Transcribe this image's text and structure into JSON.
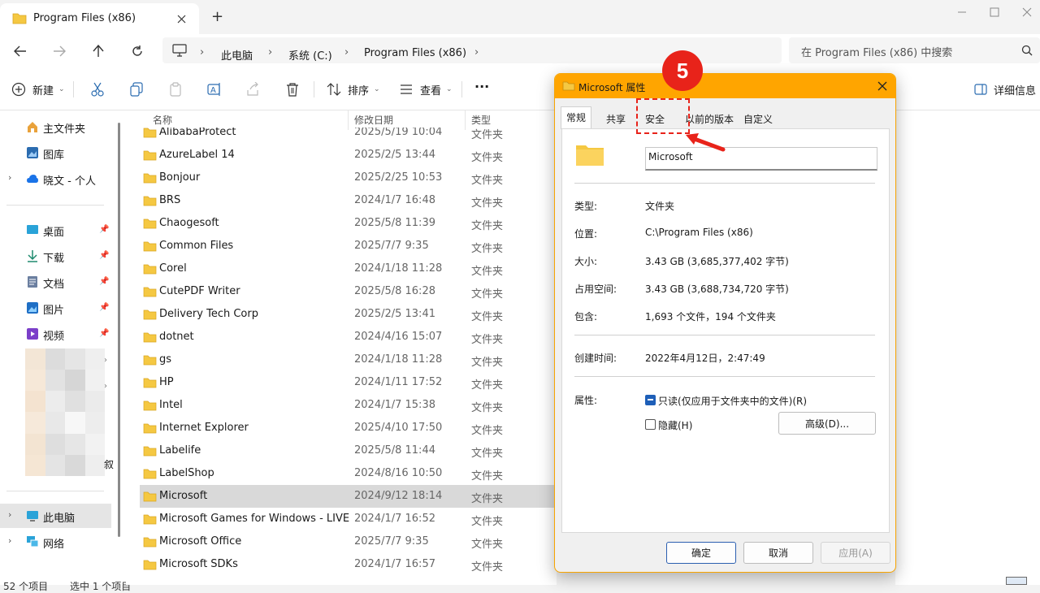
{
  "window": {
    "tab_title": "Program Files (x86)",
    "new_tab": "+"
  },
  "address": {
    "crumbs": [
      "此电脑",
      "系统 (C:)",
      "Program Files (x86)"
    ],
    "search_placeholder": "在 Program Files (x86) 中搜索"
  },
  "toolbar": {
    "new": "新建",
    "sort": "排序",
    "view": "查看",
    "more": "···",
    "details": "详细信息"
  },
  "nav": {
    "home": "主文件夹",
    "gallery": "图库",
    "onedrive": "晓文 - 个人",
    "desktop": "桌面",
    "downloads": "下载",
    "documents": "文档",
    "pictures": "图片",
    "videos": "视频",
    "this_pc": "此电脑",
    "network": "网络",
    "blur_suffix": "叙"
  },
  "list": {
    "headers": {
      "name": "名称",
      "date": "修改日期",
      "type": "类型"
    },
    "rows": [
      {
        "name": "AlibabaProtect",
        "date": "2025/5/19 10:04",
        "type": "文件夹"
      },
      {
        "name": "AzureLabel 14",
        "date": "2025/2/5 13:44",
        "type": "文件夹"
      },
      {
        "name": "Bonjour",
        "date": "2025/2/25 10:53",
        "type": "文件夹"
      },
      {
        "name": "BRS",
        "date": "2024/1/7 16:48",
        "type": "文件夹"
      },
      {
        "name": "Chaogesoft",
        "date": "2025/5/8 11:39",
        "type": "文件夹"
      },
      {
        "name": "Common Files",
        "date": "2025/7/7 9:35",
        "type": "文件夹"
      },
      {
        "name": "Corel",
        "date": "2024/1/18 11:28",
        "type": "文件夹"
      },
      {
        "name": "CutePDF Writer",
        "date": "2025/5/8 16:28",
        "type": "文件夹"
      },
      {
        "name": "Delivery Tech Corp",
        "date": "2025/2/5 13:41",
        "type": "文件夹"
      },
      {
        "name": "dotnet",
        "date": "2024/4/16 15:07",
        "type": "文件夹"
      },
      {
        "name": "gs",
        "date": "2024/1/18 11:28",
        "type": "文件夹"
      },
      {
        "name": "HP",
        "date": "2024/1/11 17:52",
        "type": "文件夹"
      },
      {
        "name": "Intel",
        "date": "2024/1/7 15:38",
        "type": "文件夹"
      },
      {
        "name": "Internet Explorer",
        "date": "2025/4/10 17:50",
        "type": "文件夹"
      },
      {
        "name": "Labelife",
        "date": "2025/5/8 11:44",
        "type": "文件夹"
      },
      {
        "name": "LabelShop",
        "date": "2024/8/16 10:50",
        "type": "文件夹"
      },
      {
        "name": "Microsoft",
        "date": "2024/9/12 18:14",
        "type": "文件夹"
      },
      {
        "name": "Microsoft Games for Windows - LIVE",
        "date": "2024/1/7 16:52",
        "type": "文件夹"
      },
      {
        "name": "Microsoft Office",
        "date": "2025/7/7 9:35",
        "type": "文件夹"
      },
      {
        "name": "Microsoft SDKs",
        "date": "2024/1/7 16:57",
        "type": "文件夹"
      }
    ]
  },
  "status": {
    "count": "52 个项目",
    "selected": "选中 1 个项目"
  },
  "dialog": {
    "title": "Microsoft 属性",
    "tabs": [
      "常规",
      "共享",
      "安全",
      "以前的版本",
      "自定义"
    ],
    "folder_name": "Microsoft",
    "props": {
      "type_label": "类型:",
      "type_value": "文件夹",
      "location_label": "位置:",
      "location_value": "C:\\Program Files (x86)",
      "size_label": "大小:",
      "size_value": "3.43 GB (3,685,377,402 字节)",
      "disk_label": "占用空间:",
      "disk_value": "3.43 GB (3,688,734,720 字节)",
      "contains_label": "包含:",
      "contains_value": "1,693 个文件，194 个文件夹",
      "created_label": "创建时间:",
      "created_value": "2022年4月12日，2:47:49",
      "attr_label": "属性:",
      "readonly": "只读(仅应用于文件夹中的文件)(R)",
      "hidden": "隐藏(H)",
      "advanced": "高级(D)..."
    },
    "buttons": {
      "ok": "确定",
      "cancel": "取消",
      "apply": "应用(A)"
    }
  },
  "annotation": {
    "step": "5"
  },
  "colors": {
    "accent": "#ffa500",
    "annotation": "#e8231a",
    "folder": "#f5c842"
  }
}
